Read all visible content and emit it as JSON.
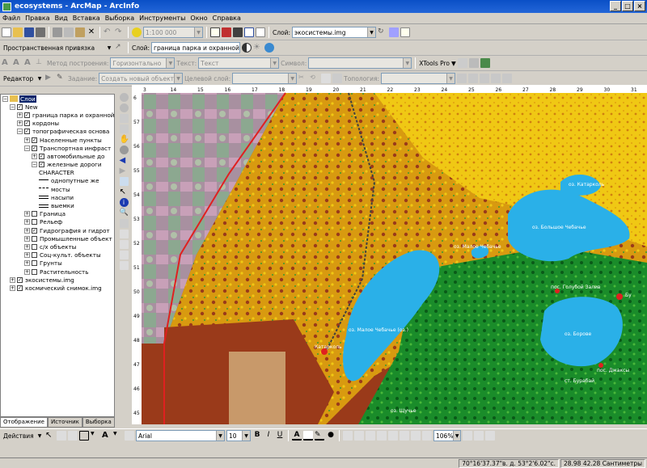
{
  "window": {
    "title": "ecosystems - ArcMap - ArcInfo"
  },
  "menu": [
    "Файл",
    "Правка",
    "Вид",
    "Вставка",
    "Выборка",
    "Инструменты",
    "Окно",
    "Справка"
  ],
  "standard": {
    "scale": "1:100 000",
    "layer_label": "Слой:",
    "layer_value": "экосистемы.img"
  },
  "spatial": {
    "label": "Пространственная привязка",
    "layer_label": "Слой:",
    "layer_value": "граница парка и охранной зоны"
  },
  "construct": {
    "method_label": "Метод построения:",
    "method_value": "Горизонтально",
    "text_label": "Текст:",
    "text_value": "Текст",
    "symbol_label": "Символ:",
    "xtools": "XTools Pro"
  },
  "editor": {
    "label": "Редактор",
    "task_label": "Задание:",
    "task_value": "Создать новый объект",
    "target_label": "Целевой слой:",
    "topology_label": "Топология:"
  },
  "toc": {
    "root": "Слои",
    "items": [
      {
        "label": "New",
        "lvl": 1,
        "exp": "-",
        "chk": true
      },
      {
        "label": "граница парка и охранной",
        "lvl": 2,
        "exp": "+",
        "chk": true
      },
      {
        "label": "кордоны",
        "lvl": 2,
        "exp": "+",
        "chk": true
      },
      {
        "label": "топографическая основа",
        "lvl": 2,
        "exp": "-",
        "chk": true
      },
      {
        "label": "Населенные пункты",
        "lvl": 3,
        "exp": "+",
        "chk": true
      },
      {
        "label": "Транспортная инфраст",
        "lvl": 3,
        "exp": "-",
        "chk": true
      },
      {
        "label": "автомобильные до",
        "lvl": 4,
        "exp": "+",
        "chk": true
      },
      {
        "label": "железные дороги",
        "lvl": 4,
        "exp": "-",
        "chk": true
      },
      {
        "label": "CHARACTER",
        "lvl": 5,
        "exp": "",
        "chk": null
      },
      {
        "label": "однопутные же",
        "lvl": 5,
        "exp": "",
        "chk": null,
        "sym": "line"
      },
      {
        "label": "мосты",
        "lvl": 5,
        "exp": "",
        "chk": null,
        "sym": "dash"
      },
      {
        "label": "насыпи",
        "lvl": 5,
        "exp": "",
        "chk": null,
        "sym": "hatch"
      },
      {
        "label": "выемки",
        "lvl": 5,
        "exp": "",
        "chk": null,
        "sym": "hatch"
      },
      {
        "label": "Граница",
        "lvl": 3,
        "exp": "+",
        "chk": false
      },
      {
        "label": "Рельеф",
        "lvl": 3,
        "exp": "+",
        "chk": false
      },
      {
        "label": "Гидрография и гидрот",
        "lvl": 3,
        "exp": "+",
        "chk": true
      },
      {
        "label": "Промышленные объект",
        "lvl": 3,
        "exp": "+",
        "chk": false
      },
      {
        "label": "с/х объекты",
        "lvl": 3,
        "exp": "+",
        "chk": false
      },
      {
        "label": "Соц-культ. объекты",
        "lvl": 3,
        "exp": "+",
        "chk": false
      },
      {
        "label": "Грунты",
        "lvl": 3,
        "exp": "+",
        "chk": false
      },
      {
        "label": "Растительность",
        "lvl": 3,
        "exp": "+",
        "chk": false
      },
      {
        "label": "экосистемы.img",
        "lvl": 1,
        "exp": "+",
        "chk": true
      },
      {
        "label": "космический снимок.img",
        "lvl": 1,
        "exp": "+",
        "chk": true
      }
    ]
  },
  "toc_tabs": [
    "Отображение",
    "Источник",
    "Выборка"
  ],
  "ruler_top": [
    "3",
    "14",
    "15",
    "16",
    "17",
    "18",
    "19",
    "20",
    "21",
    "22",
    "23",
    "24",
    "25",
    "26",
    "27",
    "28",
    "29",
    "30",
    "31"
  ],
  "ruler_left": [
    "6",
    "57",
    "56",
    "55",
    "54",
    "53",
    "52",
    "51",
    "50",
    "49",
    "48",
    "47",
    "46",
    "45"
  ],
  "map_labels": {
    "lake1": "оз. Большое Чебачье",
    "lake2": "оз. Малое Чебачье",
    "lake3": "оз. Малое Чебачье (оз.)",
    "lake4": "оз. Катарколь",
    "lake5": "оз. Борове",
    "town1": "пос. Голубой Залив",
    "town2": "пос. Джаксы",
    "town3": "Бу",
    "place1": "Катарколь",
    "place2": "ст. Бурабай",
    "place3": "оз. Щучье"
  },
  "drawing": {
    "label": "Действия",
    "font": "Arial",
    "size": "10",
    "zoom": "106%"
  },
  "status": {
    "coords": "70°16'37.37\"в. д. 53°2'6.02\"с.",
    "xy": "28.98  42.28 Сантиметры"
  },
  "colors": {
    "water": "#2ab0e8",
    "forest": "#1a8c2a",
    "brown": "#9a3a1a",
    "yellow": "#f0c814",
    "boundary": "#e02020"
  }
}
